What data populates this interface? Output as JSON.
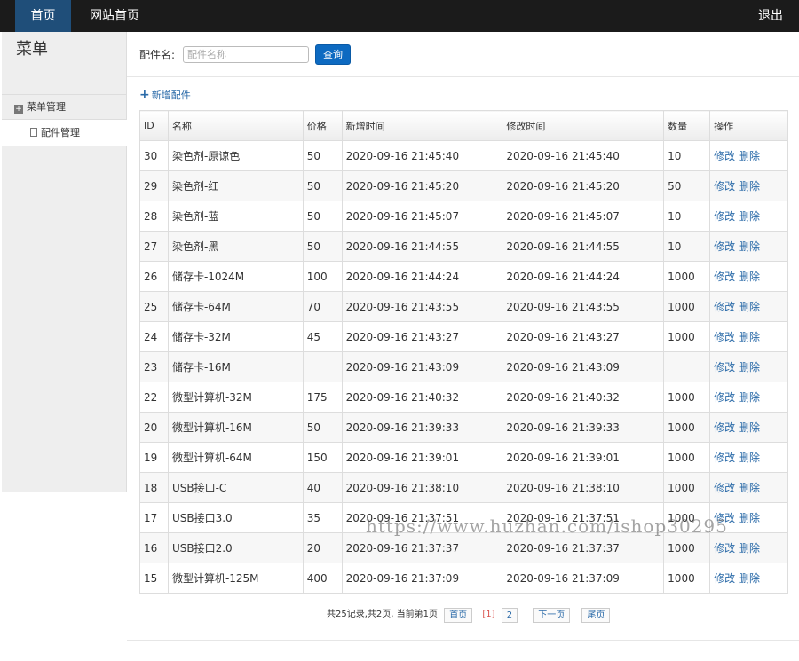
{
  "topbar": {
    "home": "首页",
    "site_home": "网站首页",
    "logout": "退出"
  },
  "sidebar": {
    "title": "菜单",
    "group_icon": "plus-box-icon",
    "group": "菜单管理",
    "item_icon": "file-icon",
    "item": "配件管理"
  },
  "search": {
    "label": "配件名:",
    "placeholder": "配件名称",
    "button": "查询"
  },
  "add_link": "新增配件",
  "table": {
    "headers": [
      "ID",
      "名称",
      "价格",
      "新增时间",
      "修改时间",
      "数量",
      "操作"
    ],
    "rows": [
      [
        "30",
        "染色剂-原谅色",
        "50",
        "2020-09-16 21:45:40",
        "2020-09-16 21:45:40",
        "10"
      ],
      [
        "29",
        "染色剂-红",
        "50",
        "2020-09-16 21:45:20",
        "2020-09-16 21:45:20",
        "50"
      ],
      [
        "28",
        "染色剂-蓝",
        "50",
        "2020-09-16 21:45:07",
        "2020-09-16 21:45:07",
        "10"
      ],
      [
        "27",
        "染色剂-黑",
        "50",
        "2020-09-16 21:44:55",
        "2020-09-16 21:44:55",
        "10"
      ],
      [
        "26",
        "储存卡-1024M",
        "100",
        "2020-09-16 21:44:24",
        "2020-09-16 21:44:24",
        "1000"
      ],
      [
        "25",
        "储存卡-64M",
        "70",
        "2020-09-16 21:43:55",
        "2020-09-16 21:43:55",
        "1000"
      ],
      [
        "24",
        "储存卡-32M",
        "45",
        "2020-09-16 21:43:27",
        "2020-09-16 21:43:27",
        "1000"
      ],
      [
        "23",
        "储存卡-16M",
        "",
        "2020-09-16 21:43:09",
        "2020-09-16 21:43:09",
        ""
      ],
      [
        "22",
        "微型计算机-32M",
        "175",
        "2020-09-16 21:40:32",
        "2020-09-16 21:40:32",
        "1000"
      ],
      [
        "20",
        "微型计算机-16M",
        "50",
        "2020-09-16 21:39:33",
        "2020-09-16 21:39:33",
        "1000"
      ],
      [
        "19",
        "微型计算机-64M",
        "150",
        "2020-09-16 21:39:01",
        "2020-09-16 21:39:01",
        "1000"
      ],
      [
        "18",
        "USB接口-C",
        "40",
        "2020-09-16 21:38:10",
        "2020-09-16 21:38:10",
        "1000"
      ],
      [
        "17",
        "USB接口3.0",
        "35",
        "2020-09-16 21:37:51",
        "2020-09-16 21:37:51",
        "1000"
      ],
      [
        "16",
        "USB接口2.0",
        "20",
        "2020-09-16 21:37:37",
        "2020-09-16 21:37:37",
        "1000"
      ],
      [
        "15",
        "微型计算机-125M",
        "400",
        "2020-09-16 21:37:09",
        "2020-09-16 21:37:09",
        "1000"
      ]
    ],
    "edit_label": "修改",
    "delete_label": "删除"
  },
  "pager": {
    "summary": "共25记录,共2页, 当前第1页",
    "first": "首页",
    "current": "[1]",
    "page2": "2",
    "next": "下一页",
    "last": "尾页"
  },
  "watermark": "https://www.huzhan.com/ishop30295"
}
